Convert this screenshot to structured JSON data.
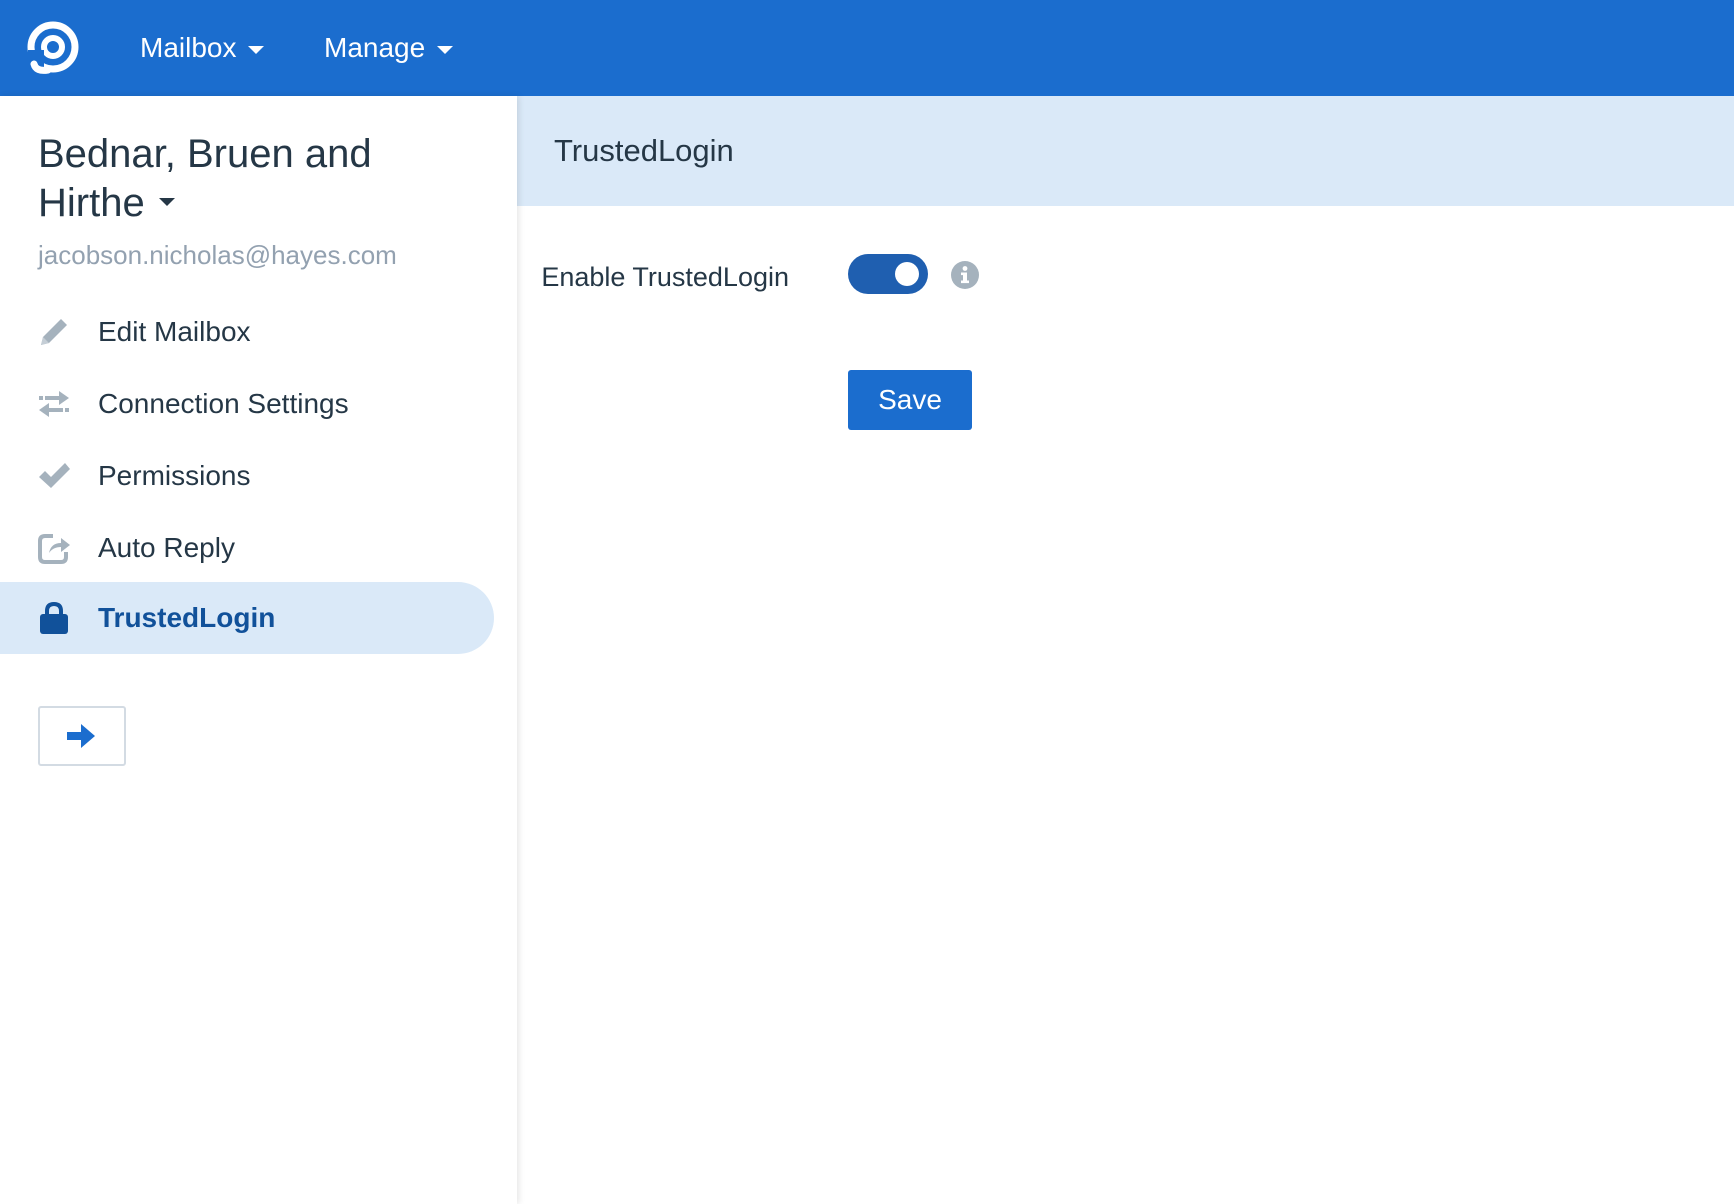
{
  "navbar": {
    "logo_icon": "helpscout-logo-icon",
    "menus": [
      {
        "label": "Mailbox"
      },
      {
        "label": "Manage"
      }
    ]
  },
  "sidebar": {
    "mailbox_name": "Bednar, Bruen and Hirthe",
    "mailbox_email": "jacobson.nicholas@hayes.com",
    "items": [
      {
        "label": "Edit Mailbox",
        "icon": "pencil-icon"
      },
      {
        "label": "Connection Settings",
        "icon": "arrows-exchange-icon"
      },
      {
        "label": "Permissions",
        "icon": "checkmark-icon"
      },
      {
        "label": "Auto Reply",
        "icon": "reply-share-icon"
      },
      {
        "label": "TrustedLogin",
        "icon": "lock-icon",
        "active": true
      }
    ],
    "toggle_icon": "arrow-right-icon"
  },
  "main": {
    "title": "TrustedLogin",
    "field_label": "Enable TrustedLogin",
    "toggle_on": true,
    "save_label": "Save"
  },
  "colors": {
    "navbar": "#1b6dce",
    "active_bg": "#dae9f8",
    "active_text": "#11519a",
    "toggle_on": "#1f5fb0",
    "icon_gray": "#a5b2bd"
  }
}
